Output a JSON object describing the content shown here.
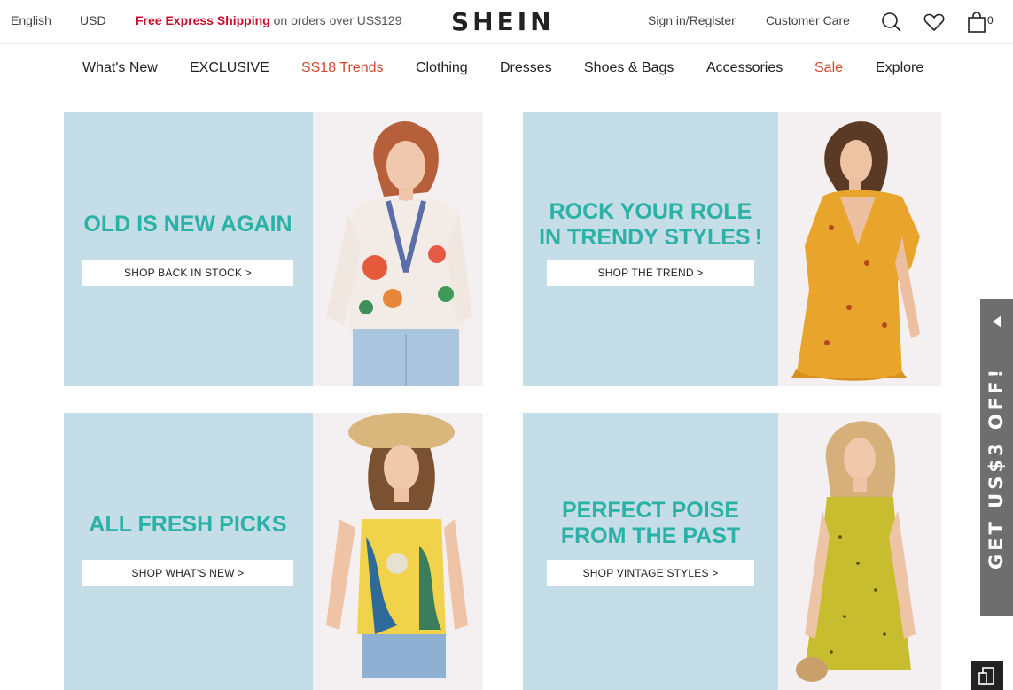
{
  "topbar": {
    "language": "English",
    "currency": "USD",
    "promo_highlight": "Free Express Shipping",
    "promo_rest": " on orders over US$129",
    "logo": "SHEIN",
    "sign_in": "Sign in/Register",
    "customer_care": "Customer Care",
    "bag_count": "0",
    "icons": [
      "search-icon",
      "heart-icon",
      "shopping-bag-icon"
    ]
  },
  "nav": {
    "items": [
      {
        "label": "What's New"
      },
      {
        "label": "EXCLUSIVE"
      },
      {
        "label": "SS18 Trends"
      },
      {
        "label": "Clothing"
      },
      {
        "label": "Dresses"
      },
      {
        "label": "Shoes & Bags"
      },
      {
        "label": "Accessories"
      },
      {
        "label": "Sale"
      },
      {
        "label": "Explore"
      }
    ],
    "accent_color": "#d2492a"
  },
  "banners": [
    {
      "headline_lines": [
        "OLD IS NEW AGAIN"
      ],
      "cta": "SHOP BACK IN STOCK >"
    },
    {
      "headline_lines": [
        "ROCK YOUR ROLE",
        "IN TRENDY STYLES !"
      ],
      "cta": "SHOP THE TREND >"
    },
    {
      "headline_lines": [
        "ALL FRESH PICKS"
      ],
      "cta": "SHOP WHAT'S NEW >"
    },
    {
      "headline_lines": [
        "PERFECT POISE",
        "FROM THE PAST"
      ],
      "cta": "SHOP VINTAGE STYLES >"
    }
  ],
  "side_tab": {
    "label": "GET US$3 OFF!"
  },
  "colors": {
    "banner_bg": "#c5dde7",
    "headline": "#2bb1a6",
    "promo_red": "#c8102e"
  }
}
